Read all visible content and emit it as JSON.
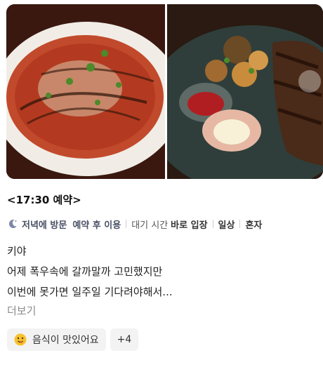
{
  "photos": {
    "left_alt": "lasagna-photo",
    "right_alt": "ribs-photo"
  },
  "reservation_title": "<17:30 예약>",
  "visit_info": {
    "time_of_visit": "저녁에 방문",
    "reservation": "예약 후 이용",
    "wait_label": "대기 시간",
    "wait_value": "바로 입장",
    "purpose": "일상",
    "companion": "혼자"
  },
  "review": {
    "lines": [
      "키야",
      "어제 폭우속에 갈까말까 고민했지만",
      "이번에 못가면 일주일 기다려야해서..."
    ],
    "more_label": "더보기"
  },
  "keywords": {
    "first_label": "음식이 맛있어요",
    "more_count": "+4"
  },
  "colors": {
    "accent_text": "#4a5166",
    "chip_bg": "#f3f3f3",
    "moon": "#7d87a8"
  },
  "icons": {
    "moon": "crescent-moon-icon",
    "smile": "yum-face-icon"
  }
}
